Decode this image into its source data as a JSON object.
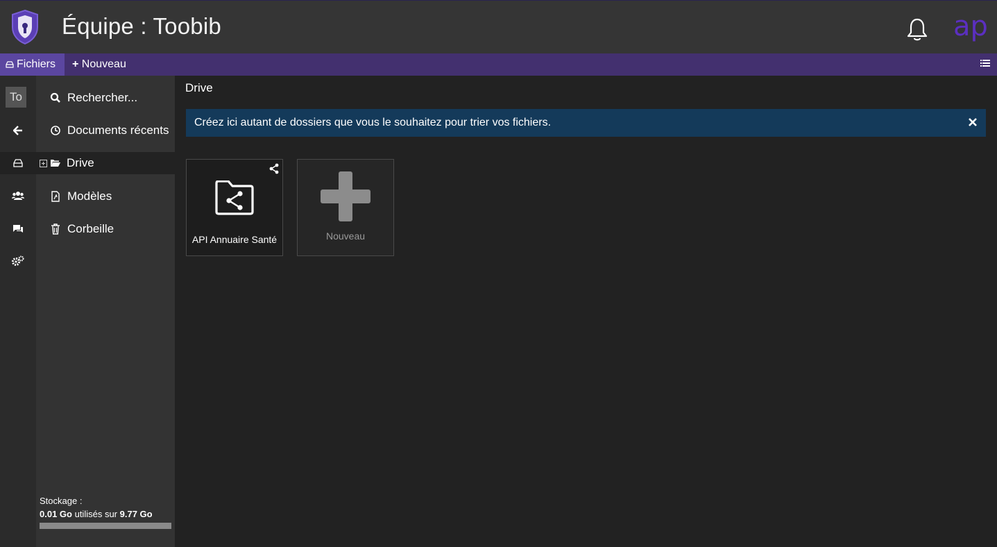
{
  "header": {
    "team_title": "Équipe : Toobib",
    "avatar_initials": "ap",
    "accent_color": "#5b2fc0"
  },
  "toolbar": {
    "files_label": "Fichiers",
    "new_label": "Nouveau",
    "bar_color": "#43306f"
  },
  "rail": {
    "team_short": "To",
    "icons": [
      "back-arrow-icon",
      "drive-icon",
      "users-icon",
      "chat-icon",
      "settings-icon"
    ]
  },
  "sidebar": {
    "search_label": "Rechercher...",
    "recent_label": "Documents récents",
    "drive_label": "Drive",
    "templates_label": "Modèles",
    "trash_label": "Corbeille",
    "storage_title": "Stockage :",
    "storage_used": "0.01 Go",
    "storage_mid": "utilisés sur",
    "storage_total": "9.77 Go"
  },
  "main": {
    "breadcrumb": "Drive",
    "info_message": "Créez ici autant de dossiers que vous le souhaitez pour trier vos fichiers.",
    "info_color": "#143a5a",
    "folder_name": "API Annuaire Santé",
    "new_tile_label": "Nouveau"
  }
}
